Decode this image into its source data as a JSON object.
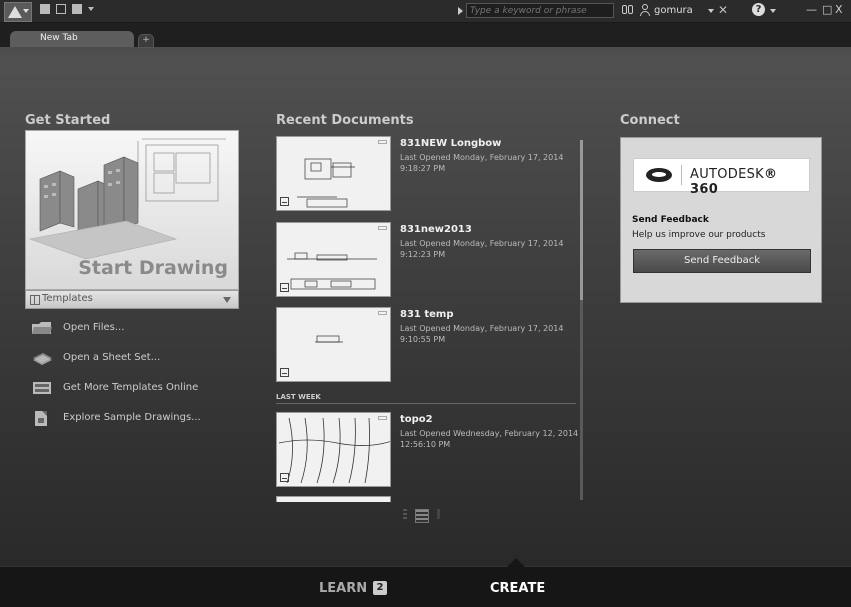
{
  "titlebar": {
    "search_placeholder": "Type a keyword or phrase",
    "user_name": "gomura",
    "help_label": "?",
    "minimize": "—",
    "restore": "□",
    "close": "X"
  },
  "tabs": {
    "active_label": "New Tab",
    "add_label": "+"
  },
  "get_started": {
    "title": "Get Started",
    "start_label": "Start Drawing",
    "templates_label": "Templates",
    "items": [
      {
        "label": "Open Files...",
        "icon": "folder-icon"
      },
      {
        "label": "Open a Sheet Set...",
        "icon": "sheet-set-icon"
      },
      {
        "label": "Get More Templates Online",
        "icon": "templates-online-icon"
      },
      {
        "label": "Explore Sample Drawings...",
        "icon": "sample-drawings-icon"
      }
    ]
  },
  "recent": {
    "title": "Recent Documents",
    "last_week_label": "LAST WEEK",
    "docs": [
      {
        "name": "831NEW Longbow",
        "meta": "Last Opened Monday, February 17, 2014 9:18:27 PM"
      },
      {
        "name": "831new2013",
        "meta": "Last Opened Monday, February 17, 2014 9:12:23 PM"
      },
      {
        "name": "831 temp",
        "meta": "Last Opened Monday, February 17, 2014 9:10:55 PM"
      },
      {
        "name": "topo2",
        "meta": "Last Opened Wednesday, February 12, 2014 12:56:10 PM"
      }
    ]
  },
  "connect": {
    "title": "Connect",
    "brand_name": "AUTODESK",
    "brand_suffix": "® 360",
    "feedback_title": "Send Feedback",
    "feedback_sub": "Help us improve our products",
    "feedback_button": "Send Feedback"
  },
  "bottom": {
    "learn_label": "LEARN",
    "learn_badge": "2",
    "create_label": "CREATE"
  }
}
